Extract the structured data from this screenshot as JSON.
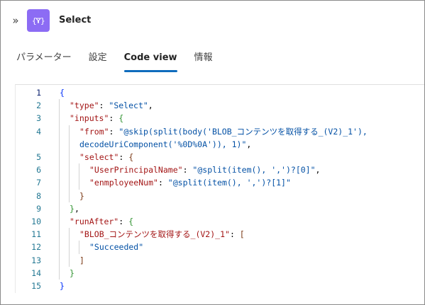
{
  "header": {
    "collapse_icon": "double-chevron-right-icon",
    "action_icon": "select-data-operation-icon",
    "title": "Select"
  },
  "tabs": [
    {
      "label": "パラメーター",
      "active": false
    },
    {
      "label": "設定",
      "active": false
    },
    {
      "label": "Code view",
      "active": true
    },
    {
      "label": "情報",
      "active": false
    }
  ],
  "code": {
    "lines": [
      {
        "num": "1",
        "tokens": [
          {
            "t": "{",
            "c": "b1"
          }
        ]
      },
      {
        "num": "2",
        "tokens": [
          {
            "t": "\"type\"",
            "c": "k"
          },
          {
            "t": ": ",
            "c": "p"
          },
          {
            "t": "\"Select\"",
            "c": "s"
          },
          {
            "t": ",",
            "c": "p"
          }
        ]
      },
      {
        "num": "3",
        "tokens": [
          {
            "t": "\"inputs\"",
            "c": "k"
          },
          {
            "t": ": ",
            "c": "p"
          },
          {
            "t": "{",
            "c": "b2"
          }
        ]
      },
      {
        "num": "4",
        "tokens": [
          {
            "t": "\"from\"",
            "c": "k"
          },
          {
            "t": ": ",
            "c": "p"
          },
          {
            "t": "\"@skip(split(body('BLOB_コンテンツを取得する_(V2)_1'),",
            "c": "s"
          }
        ]
      },
      {
        "num": "",
        "tokens": [
          {
            "t": "decodeUriComponent('%0D%0A')), 1)\"",
            "c": "s"
          },
          {
            "t": ",",
            "c": "p"
          }
        ]
      },
      {
        "num": "5",
        "tokens": [
          {
            "t": "\"select\"",
            "c": "k"
          },
          {
            "t": ": ",
            "c": "p"
          },
          {
            "t": "{",
            "c": "b3"
          }
        ]
      },
      {
        "num": "6",
        "tokens": [
          {
            "t": "\"UserPrincipalName\"",
            "c": "k"
          },
          {
            "t": ": ",
            "c": "p"
          },
          {
            "t": "\"@split(item(), ',')?[0]\"",
            "c": "s"
          },
          {
            "t": ",",
            "c": "p"
          }
        ]
      },
      {
        "num": "7",
        "tokens": [
          {
            "t": "\"enmployeeNum\"",
            "c": "k"
          },
          {
            "t": ": ",
            "c": "p"
          },
          {
            "t": "\"@split(item(), ',')?[1]\"",
            "c": "s"
          }
        ]
      },
      {
        "num": "8",
        "tokens": [
          {
            "t": "}",
            "c": "b3"
          }
        ]
      },
      {
        "num": "9",
        "tokens": [
          {
            "t": "}",
            "c": "b2"
          },
          {
            "t": ",",
            "c": "p"
          }
        ]
      },
      {
        "num": "10",
        "tokens": [
          {
            "t": "\"runAfter\"",
            "c": "k"
          },
          {
            "t": ": ",
            "c": "p"
          },
          {
            "t": "{",
            "c": "b2"
          }
        ]
      },
      {
        "num": "11",
        "tokens": [
          {
            "t": "\"BLOB_コンテンツを取得する_(V2)_1\"",
            "c": "k"
          },
          {
            "t": ": ",
            "c": "p"
          },
          {
            "t": "[",
            "c": "b3"
          }
        ]
      },
      {
        "num": "12",
        "tokens": [
          {
            "t": "\"Succeeded\"",
            "c": "s"
          }
        ]
      },
      {
        "num": "13",
        "tokens": [
          {
            "t": "]",
            "c": "b3"
          }
        ]
      },
      {
        "num": "14",
        "tokens": [
          {
            "t": "}",
            "c": "b2"
          }
        ]
      },
      {
        "num": "15",
        "tokens": [
          {
            "t": "}",
            "c": "b1"
          }
        ]
      }
    ],
    "active_line": "1"
  },
  "colors": {
    "accent": "#0f6cbd",
    "icon_bg": "#8c6cf4",
    "json_key": "#a31515",
    "json_string": "#0451a5",
    "line_number": "#237893"
  }
}
